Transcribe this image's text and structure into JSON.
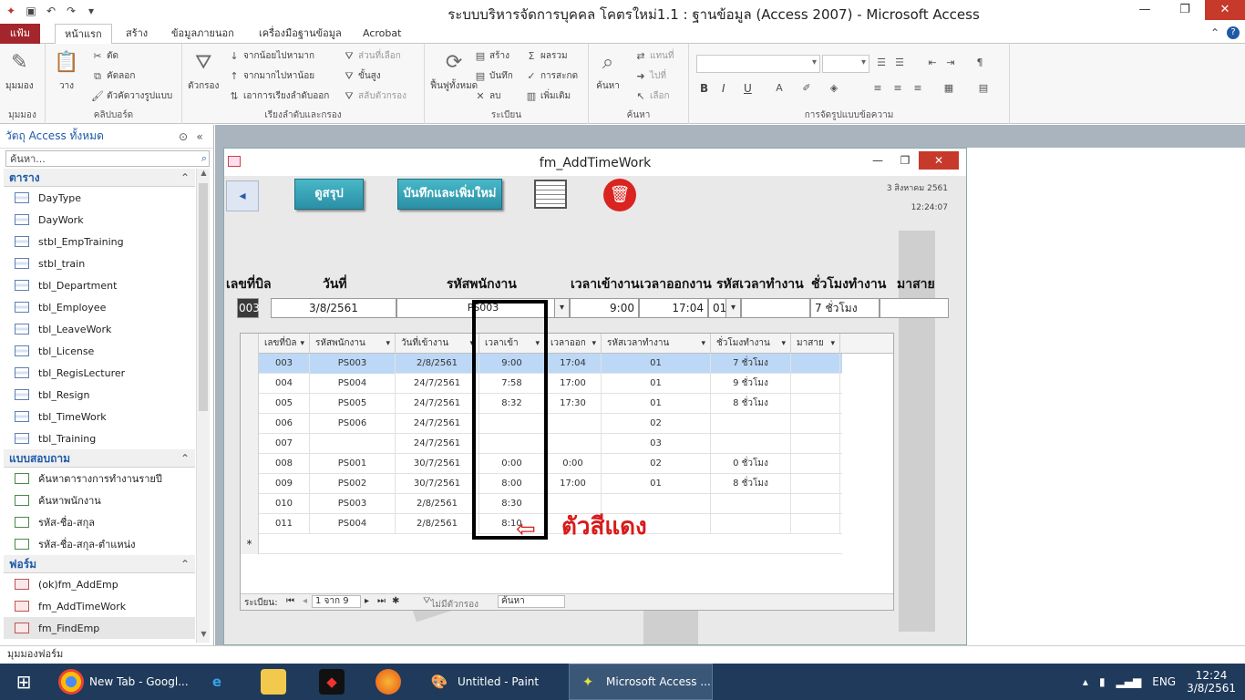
{
  "window": {
    "title": "ระบบบริหารจัดการบุคคล โคตรใหม่1.1 : ฐานข้อมูล (Access 2007) - Microsoft Access",
    "minimize": "—",
    "restore": "❐",
    "close": "✕"
  },
  "ribbon_tabs": {
    "file": "แฟ้ม",
    "home": "หน้าแรก",
    "create": "สร้าง",
    "external": "ข้อมูลภายนอก",
    "dbtools": "เครื่องมือฐานข้อมูล",
    "acrobat": "Acrobat"
  },
  "ribbon": {
    "views": {
      "view": "มุมมอง",
      "label": "มุมมอง"
    },
    "clipboard": {
      "paste": "วาง",
      "cut": "ตัด",
      "copy": "คัดลอก",
      "format_painter": "ตัวคัดวางรูปแบบ",
      "label": "คลิปบอร์ด"
    },
    "sort": {
      "filter": "ตัวกรอง",
      "ascending": "จากน้อยไปหามาก",
      "descending": "จากมากไปหาน้อย",
      "remove_sort": "เอาการเรียงลำดับออก",
      "selection": "ส่วนที่เลือก",
      "advanced": "ขั้นสูง",
      "toggle_filter": "สลับตัวกรอง",
      "label": "เรียงลำดับและกรอง"
    },
    "records": {
      "refresh": "ฟื้นฟูทั้งหมด",
      "new": "สร้าง",
      "save": "บันทึก",
      "delete": "ลบ",
      "totals": "ผลรวม",
      "spelling": "การสะกด",
      "more": "เพิ่มเติม",
      "label": "ระเบียน"
    },
    "find": {
      "find": "ค้นหา",
      "replace": "แทนที่",
      "goto": "ไปที่",
      "select": "เลือก",
      "label": "ค้นหา"
    },
    "text_format": {
      "bold": "B",
      "italic": "I",
      "underline": "U",
      "label": "การจัดรูปแบบข้อความ"
    }
  },
  "nav": {
    "header": "วัตถุ Access ทั้งหมด",
    "search_value": "ค้นหา...",
    "sections": [
      {
        "title": "ตาราง",
        "items": [
          "DayType",
          "DayWork",
          "stbl_EmpTraining",
          "stbl_train",
          "tbl_Department",
          "tbl_Employee",
          "tbl_LeaveWork",
          "tbl_License",
          "tbl_RegisLecturer",
          "tbl_Resign",
          "tbl_TimeWork",
          "tbl_Training"
        ]
      },
      {
        "title": "แบบสอบถาม",
        "items": [
          "ค้นหาตารางการทำงานรายปี",
          "ค้นหาพนักงาน",
          "รหัส-ชื่อ-สกุล",
          "รหัส-ชื่อ-สกุล-ตำแหน่ง"
        ]
      },
      {
        "title": "ฟอร์ม",
        "items": [
          "(ok)fm_AddEmp",
          "fm_AddTimeWork",
          "fm_FindEmp"
        ]
      }
    ]
  },
  "form": {
    "title": "fm_AddTimeWork",
    "btn_summary": "ดูสรุป",
    "btn_save_new": "บันทึกและเพิ่มใหม่",
    "date_stamp": "3 สิงหาคม 2561",
    "time_stamp": "12:24:07",
    "headers": [
      "เลขที่บิล",
      "วันที่",
      "รหัสพนักงาน",
      "เวลาเข้างาน",
      "เวลาออกงาน",
      "รหัสเวลาทำงาน",
      "ชั่วโมงทำงาน",
      "มาสาย"
    ],
    "fields": {
      "bill": "003",
      "date": "3/8/2561",
      "emp": "PS003",
      "time_in": "9:00",
      "time_out": "17:04",
      "code": "01",
      "hours": "7 ชั่วโมง",
      "late": ""
    }
  },
  "datasheet": {
    "columns": [
      "เลขที่บิล",
      "รหัสพนักงาน",
      "วันที่เข้างาน",
      "เวลาเข้า",
      "เวลาออก",
      "รหัสเวลาทำงาน",
      "ชั่วโมงทำงาน",
      "มาสาย"
    ],
    "rows": [
      [
        "003",
        "PS003",
        "2/8/2561",
        "9:00",
        "17:04",
        "01",
        "7 ชั่วโมง",
        ""
      ],
      [
        "004",
        "PS004",
        "24/7/2561",
        "7:58",
        "17:00",
        "01",
        "9 ชั่วโมง",
        ""
      ],
      [
        "005",
        "PS005",
        "24/7/2561",
        "8:32",
        "17:30",
        "01",
        "8 ชั่วโมง",
        ""
      ],
      [
        "006",
        "PS006",
        "24/7/2561",
        "",
        "",
        "02",
        "",
        ""
      ],
      [
        "007",
        "",
        "24/7/2561",
        "",
        "",
        "03",
        "",
        ""
      ],
      [
        "008",
        "PS001",
        "30/7/2561",
        "0:00",
        "0:00",
        "02",
        "0 ชั่วโมง",
        ""
      ],
      [
        "009",
        "PS002",
        "30/7/2561",
        "8:00",
        "17:00",
        "01",
        "8 ชั่วโมง",
        ""
      ],
      [
        "010",
        "PS003",
        "2/8/2561",
        "8:30",
        "",
        "",
        "",
        ""
      ],
      [
        "011",
        "PS004",
        "2/8/2561",
        "8:10",
        "",
        "",
        "",
        ""
      ]
    ],
    "new_row_marker": "*",
    "recnav": {
      "label": "ระเบียน:",
      "position": "1 จาก 9",
      "no_filter": "ไม่มีตัวกรอง",
      "search": "ค้นหา"
    }
  },
  "annotation": {
    "text": "ตัวสีแดง",
    "color": "#d91a1a"
  },
  "statusbar": {
    "text": "มุมมองฟอร์ม"
  },
  "taskbar": {
    "items": [
      "New Tab - Googl...",
      "Untitled - Paint",
      "Microsoft Access ..."
    ],
    "lang": "ENG",
    "time": "12:24",
    "date": "3/8/2561"
  }
}
